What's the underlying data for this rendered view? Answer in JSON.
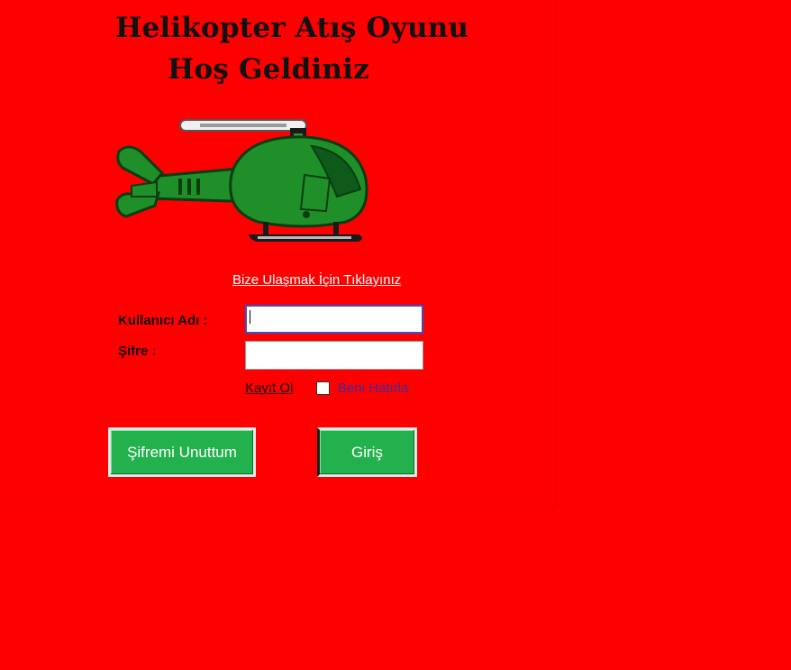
{
  "window": {
    "background": "#ff0000"
  },
  "header": {
    "title_line1": "Helikopter Atış Oyunu",
    "title_line2": "Hoş Geldiniz"
  },
  "image": {
    "icon": "helicopter-image",
    "color": "#1f8f2a"
  },
  "contact": {
    "link_label": "Bize Ulaşmak İçin Tıklayınız"
  },
  "form": {
    "username_label": "Kullanıcı Adı :",
    "username_value": "",
    "password_label": "Şifre :",
    "password_value": "",
    "register_link": "Kayıt Ol",
    "remember_label": "Beni Hatırla",
    "remember_checked": false
  },
  "buttons": {
    "forgot_label": "Şifremi Unuttum",
    "login_label": "Giriş",
    "color": "#22b14c"
  }
}
